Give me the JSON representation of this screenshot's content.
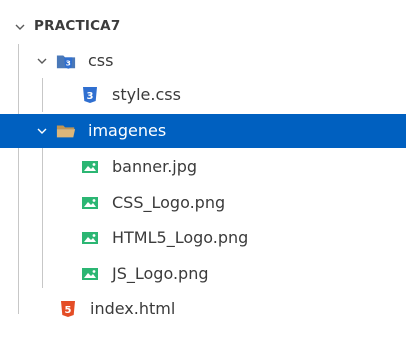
{
  "explorer": {
    "root": {
      "label": "PRACTICA7",
      "expanded": true
    },
    "css_folder": {
      "label": "css",
      "expanded": true
    },
    "style_file": {
      "label": "style.css"
    },
    "imagenes_folder": {
      "label": "imagenes",
      "expanded": true,
      "selected": true
    },
    "banner_file": {
      "label": "banner.jpg"
    },
    "css_logo_file": {
      "label": "CSS_Logo.png"
    },
    "html5_logo_file": {
      "label": "HTML5_Logo.png"
    },
    "js_logo_file": {
      "label": "JS_Logo.png"
    },
    "index_file": {
      "label": "index.html"
    }
  },
  "colors": {
    "selection": "#0060c0",
    "css_icon": "#2f6fd0",
    "html_icon": "#e44d26",
    "image_icon": "#2bb673",
    "folder_icon": "#c09553"
  },
  "icons": {
    "chevron": "chevron-down-icon",
    "css_folder": "css-folder-icon",
    "css_file": "css-file-icon",
    "folder_open": "folder-open-icon",
    "image_file": "image-file-icon",
    "html_file": "html5-file-icon"
  }
}
